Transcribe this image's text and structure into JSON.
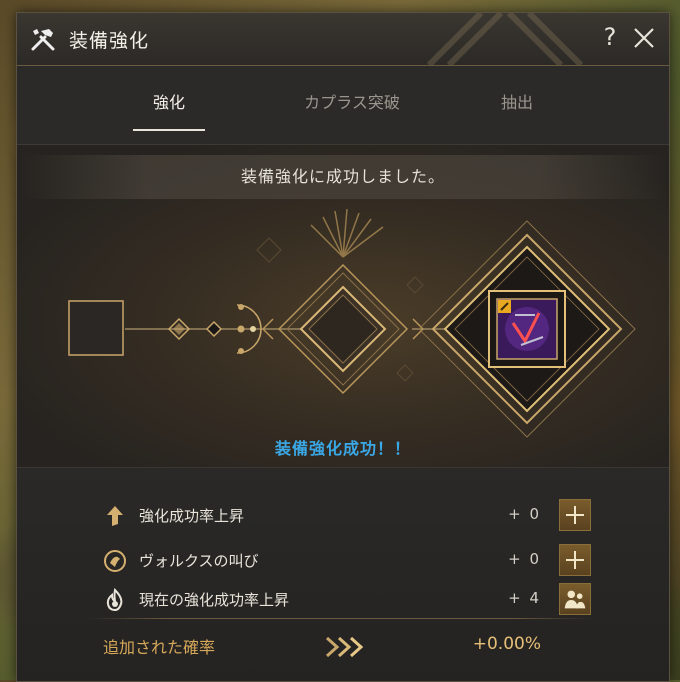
{
  "window": {
    "title": "装備強化",
    "help": "?"
  },
  "tabs": [
    {
      "label": "強化",
      "active": true
    },
    {
      "label": "カプラス突破",
      "active": false
    },
    {
      "label": "抽出",
      "active": false
    }
  ],
  "stage": {
    "message": "装備強化に成功しました。",
    "result": "装備強化成功！！"
  },
  "bonuses": [
    {
      "label": "強化成功率上昇",
      "value": "+ 0",
      "icon": "arrow-up-icon"
    },
    {
      "label": "ヴォルクスの叫び",
      "value": "+ 0",
      "icon": "valks-cry-icon"
    },
    {
      "label": "現在の強化成功率上昇",
      "value": "+ 4",
      "icon": "flame-icon"
    }
  ],
  "added": {
    "label": "追加された確率",
    "value": "+0.00%"
  },
  "colors": {
    "accent_gold": "#d6a85a",
    "success_blue": "#3aa8e6",
    "window_bg": "#262523"
  }
}
